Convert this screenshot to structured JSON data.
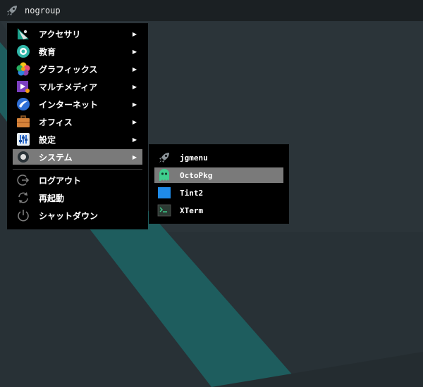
{
  "topbar": {
    "title": "nogroup",
    "launcher_icon": "rocket-icon"
  },
  "menu": {
    "items": [
      {
        "label": "アクセサリ",
        "icon": "accessories-icon",
        "has_submenu": true
      },
      {
        "label": "教育",
        "icon": "education-icon",
        "has_submenu": true
      },
      {
        "label": "グラフィックス",
        "icon": "graphics-icon",
        "has_submenu": true
      },
      {
        "label": "マルチメディア",
        "icon": "multimedia-icon",
        "has_submenu": true
      },
      {
        "label": "インターネット",
        "icon": "internet-icon",
        "has_submenu": true
      },
      {
        "label": "オフィス",
        "icon": "office-icon",
        "has_submenu": true
      },
      {
        "label": "設定",
        "icon": "settings-icon",
        "has_submenu": true
      },
      {
        "label": "システム",
        "icon": "system-icon",
        "has_submenu": true,
        "selected": true
      }
    ],
    "session": [
      {
        "label": "ログアウト",
        "icon": "logout-icon"
      },
      {
        "label": "再起動",
        "icon": "reboot-icon"
      },
      {
        "label": "シャットダウン",
        "icon": "shutdown-icon"
      }
    ],
    "submenu_arrow": "▶"
  },
  "submenu": {
    "items": [
      {
        "label": "jgmenu",
        "icon": "rocket-icon"
      },
      {
        "label": "OctoPkg",
        "icon": "octopkg-icon",
        "selected": true
      },
      {
        "label": "Tint2",
        "icon": "tint2-icon"
      },
      {
        "label": "XTerm",
        "icon": "terminal-icon"
      }
    ]
  },
  "colors": {
    "desktop_bg": "#283136",
    "stripe": "#1e5d5e",
    "menu_bg": "#000000",
    "selection": "#7a7a7a",
    "topbar_bg": "#1b2023"
  }
}
